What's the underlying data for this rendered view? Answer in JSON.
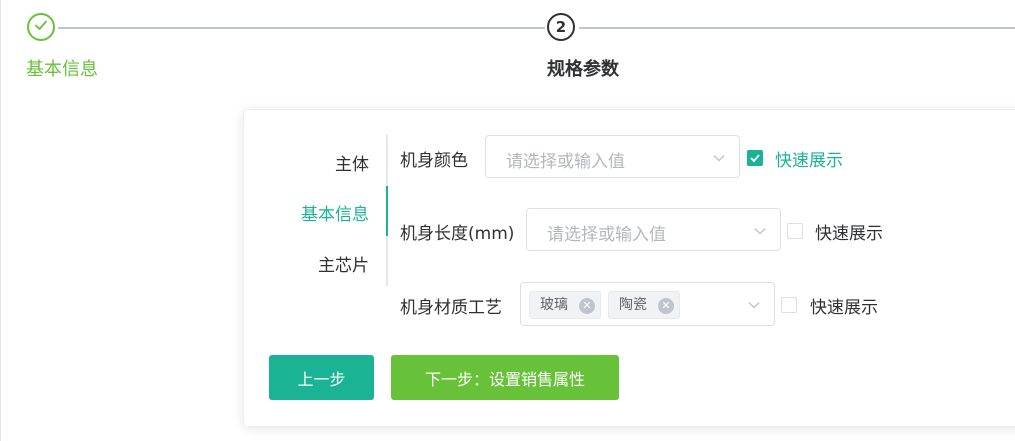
{
  "steps": [
    {
      "title": "基本信息",
      "status": "done",
      "icon": "check-icon"
    },
    {
      "title": "规格参数",
      "status": "active",
      "number": "2"
    }
  ],
  "tabs": [
    {
      "label": "主体",
      "active": false
    },
    {
      "label": "基本信息",
      "active": true
    },
    {
      "label": "主芯片",
      "active": false
    }
  ],
  "fields": [
    {
      "label": "机身颜色",
      "placeholder": "请选择或输入值",
      "quick_label": "快速展示",
      "quick_checked": true
    },
    {
      "label": "机身长度(mm)",
      "placeholder": "请选择或输入值",
      "quick_label": "快速展示",
      "quick_checked": false
    },
    {
      "label": "机身材质工艺",
      "tags": [
        "玻璃",
        "陶瓷"
      ],
      "quick_label": "快速展示",
      "quick_checked": false
    }
  ],
  "buttons": {
    "prev": "上一步",
    "next": "下一步：设置销售属性"
  },
  "colors": {
    "primary": "#1ab394",
    "success": "#67c23a",
    "text": "#303133",
    "placeholder": "#b4b7bd"
  }
}
